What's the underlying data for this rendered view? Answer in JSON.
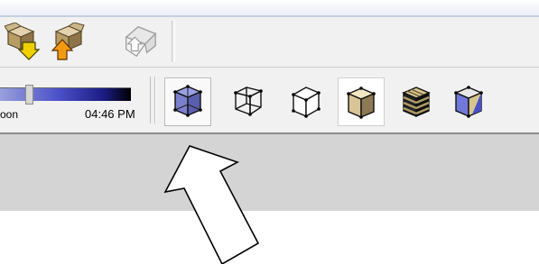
{
  "toolbar_top": {
    "buttons": [
      {
        "name": "get-models-button",
        "icon": "box-down-arrow-icon"
      },
      {
        "name": "share-model-button",
        "icon": "box-up-arrow-icon"
      },
      {
        "name": "warehouse-button",
        "icon": "house-gray-icon"
      }
    ]
  },
  "shadow": {
    "left_label": "oon",
    "time": "04:46 PM"
  },
  "face_styles": {
    "selected_index": 0,
    "buttons": [
      {
        "name": "xray-style",
        "icon": "xray-cube-icon"
      },
      {
        "name": "wireframe-style",
        "icon": "wireframe-cube-icon"
      },
      {
        "name": "hidden-line-style",
        "icon": "hidden-line-cube-icon"
      },
      {
        "name": "shaded-style",
        "icon": "shaded-cube-icon"
      },
      {
        "name": "shaded-textures-style",
        "icon": "textured-cube-icon"
      },
      {
        "name": "monochrome-style",
        "icon": "monochrome-cube-icon"
      }
    ]
  },
  "annotation": {
    "pointer": "white-arrow-icon"
  },
  "colors": {
    "toolbar_bg": "#f1f1f1",
    "status_bg": "#d4d4d4",
    "xray_blue": "#6a6ec0",
    "slider_dark": "#1a1a80"
  }
}
